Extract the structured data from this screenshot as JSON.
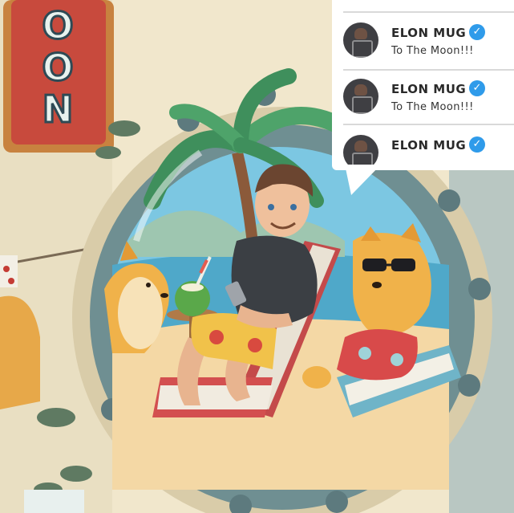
{
  "sign": {
    "letters": "OON"
  },
  "feed": {
    "items": [
      {
        "name": "ELON MUG",
        "message": "To The Moon!!!"
      },
      {
        "name": "ELON MUG",
        "message": "To The Moon!!!"
      },
      {
        "name": "ELON MUG",
        "message": ""
      }
    ],
    "verified_glyph": "✓"
  },
  "colors": {
    "sky": "#7cc7e2",
    "porthole_frame": "#6f8f92",
    "verified": "#2f9bea",
    "shiba": "#f0b24a"
  }
}
